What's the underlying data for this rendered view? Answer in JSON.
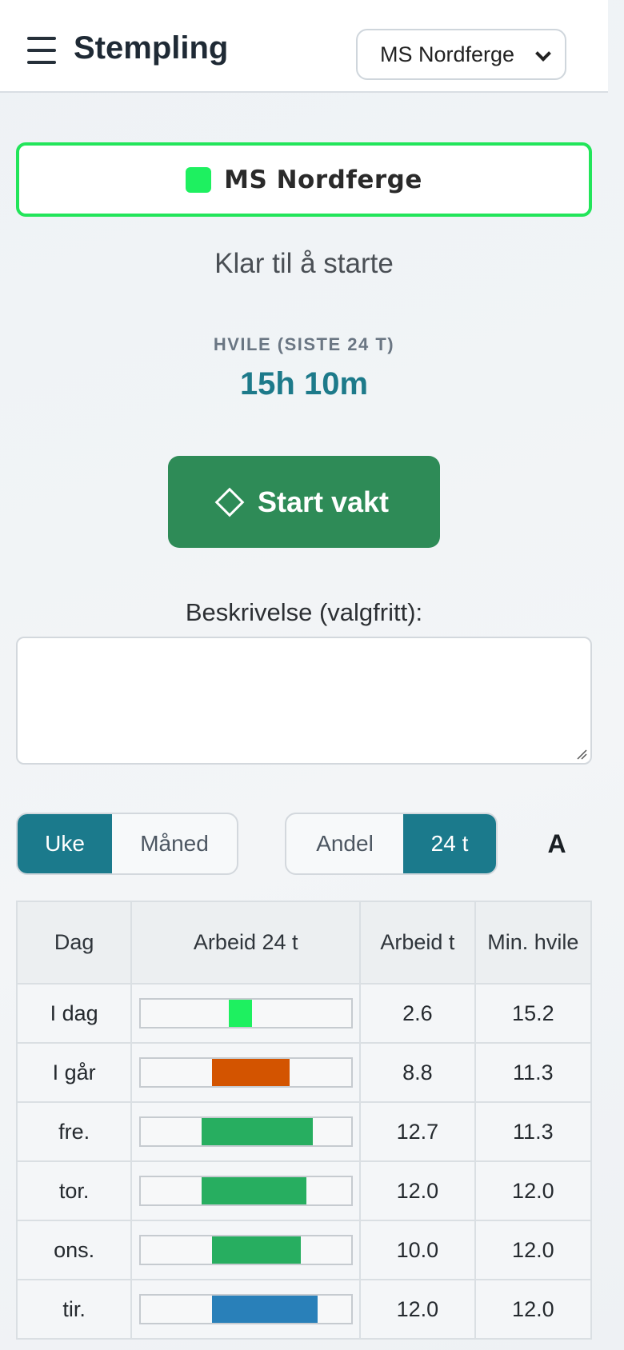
{
  "header": {
    "title": "Stempling",
    "vessel_selected": "MS Nordferge"
  },
  "status": {
    "vessel": "MS Nordferge",
    "state": "Klar til å starte",
    "rest_label": "HVILE (SISTE 24 T)",
    "rest_value": "15h 10m"
  },
  "actions": {
    "start_label": "Start vakt"
  },
  "description": {
    "label": "Beskrivelse (valgfritt):",
    "value": ""
  },
  "toggles": {
    "period": [
      {
        "label": "Uke",
        "active": true
      },
      {
        "label": "Måned",
        "active": false
      }
    ],
    "view": [
      {
        "label": "Andel",
        "active": false
      },
      {
        "label": "24 t",
        "active": true
      }
    ],
    "font_label": "A"
  },
  "colors": {
    "accent": "#1b7a8c",
    "start": "#2e8b57",
    "active_dot": "#1ef060"
  },
  "table": {
    "headers": {
      "day": "Dag",
      "bar": "Arbeid 24 t",
      "hours": "Arbeid t",
      "rest": "Min. hvile"
    },
    "rows": [
      {
        "day": "I dag",
        "hours": "2.6",
        "rest": "15.2",
        "bar_start": 0.42,
        "bar_len": 0.11,
        "color": "#1ef060"
      },
      {
        "day": "I går",
        "hours": "8.8",
        "rest": "11.3",
        "bar_start": 0.34,
        "bar_len": 0.37,
        "color": "#d35400"
      },
      {
        "day": "fre.",
        "hours": "12.7",
        "rest": "11.3",
        "bar_start": 0.29,
        "bar_len": 0.53,
        "color": "#27ae60"
      },
      {
        "day": "tor.",
        "hours": "12.0",
        "rest": "12.0",
        "bar_start": 0.29,
        "bar_len": 0.5,
        "color": "#27ae60"
      },
      {
        "day": "ons.",
        "hours": "10.0",
        "rest": "12.0",
        "bar_start": 0.34,
        "bar_len": 0.42,
        "color": "#27ae60"
      },
      {
        "day": "tir.",
        "hours": "12.0",
        "rest": "12.0",
        "bar_start": 0.34,
        "bar_len": 0.5,
        "color": "#2980b9"
      }
    ]
  }
}
